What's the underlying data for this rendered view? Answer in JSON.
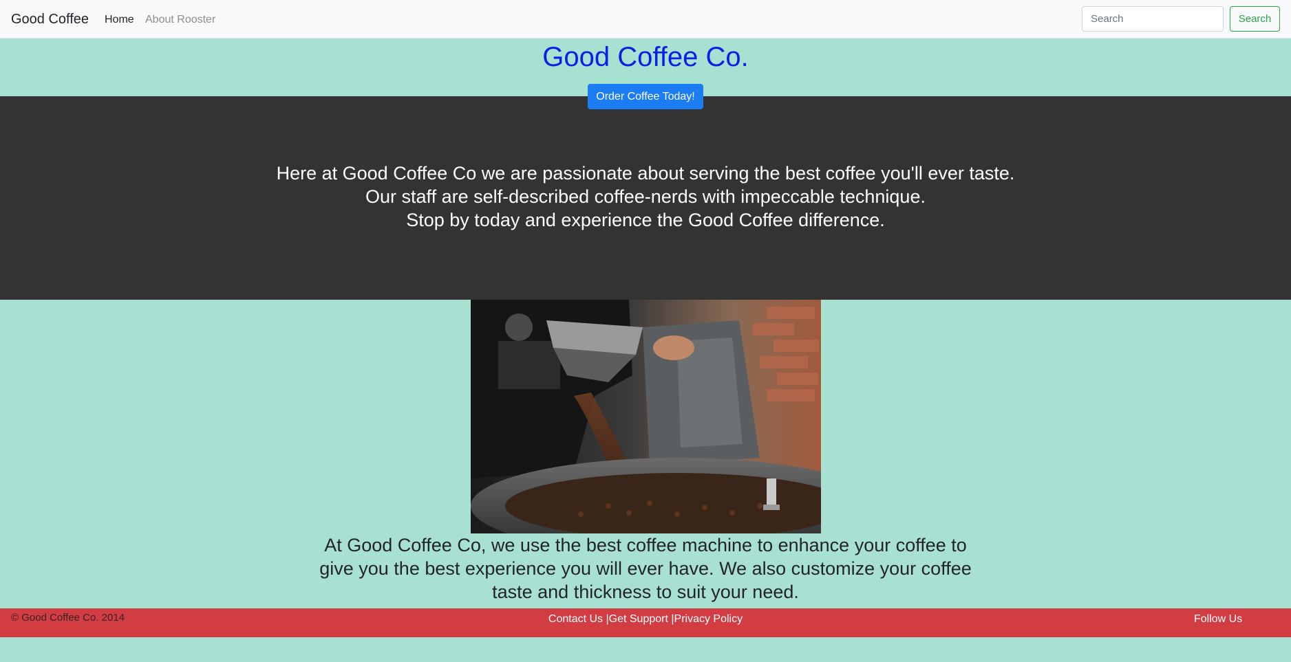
{
  "navbar": {
    "brand": "Good Coffee",
    "links": [
      "Home",
      "About Rooster"
    ],
    "search_placeholder": "Search",
    "search_button": "Search"
  },
  "hero": {
    "title": "Good Coffee Co.",
    "cta": "Order Coffee Today!"
  },
  "intro": {
    "lines": [
      "Here at Good Coffee Co we are passionate about serving the best coffee you'll ever taste.",
      "Our staff are self-described coffee-nerds with impeccable technique.",
      "Stop by today and experience the Good Coffee difference."
    ]
  },
  "feature": {
    "text": "At Good Coffee Co, we use the best coffee machine to enhance your coffee to give you the best experience you will ever have. We also customize your coffee taste and thickness to suit your need."
  },
  "footer": {
    "copyright": "© Good Coffee Co. 2014",
    "contact": "Contact Us",
    "separator": "|",
    "support": "Get Support",
    "privacy": "Privacy Policy",
    "follow": "Follow Us"
  },
  "colors": {
    "page_background": "#a8e0d1",
    "title": "#0a1ee6",
    "dark_band": "#333333",
    "primary_button": "#1c7cf2",
    "search_button": "#28a745",
    "footer": "#d13d42"
  }
}
